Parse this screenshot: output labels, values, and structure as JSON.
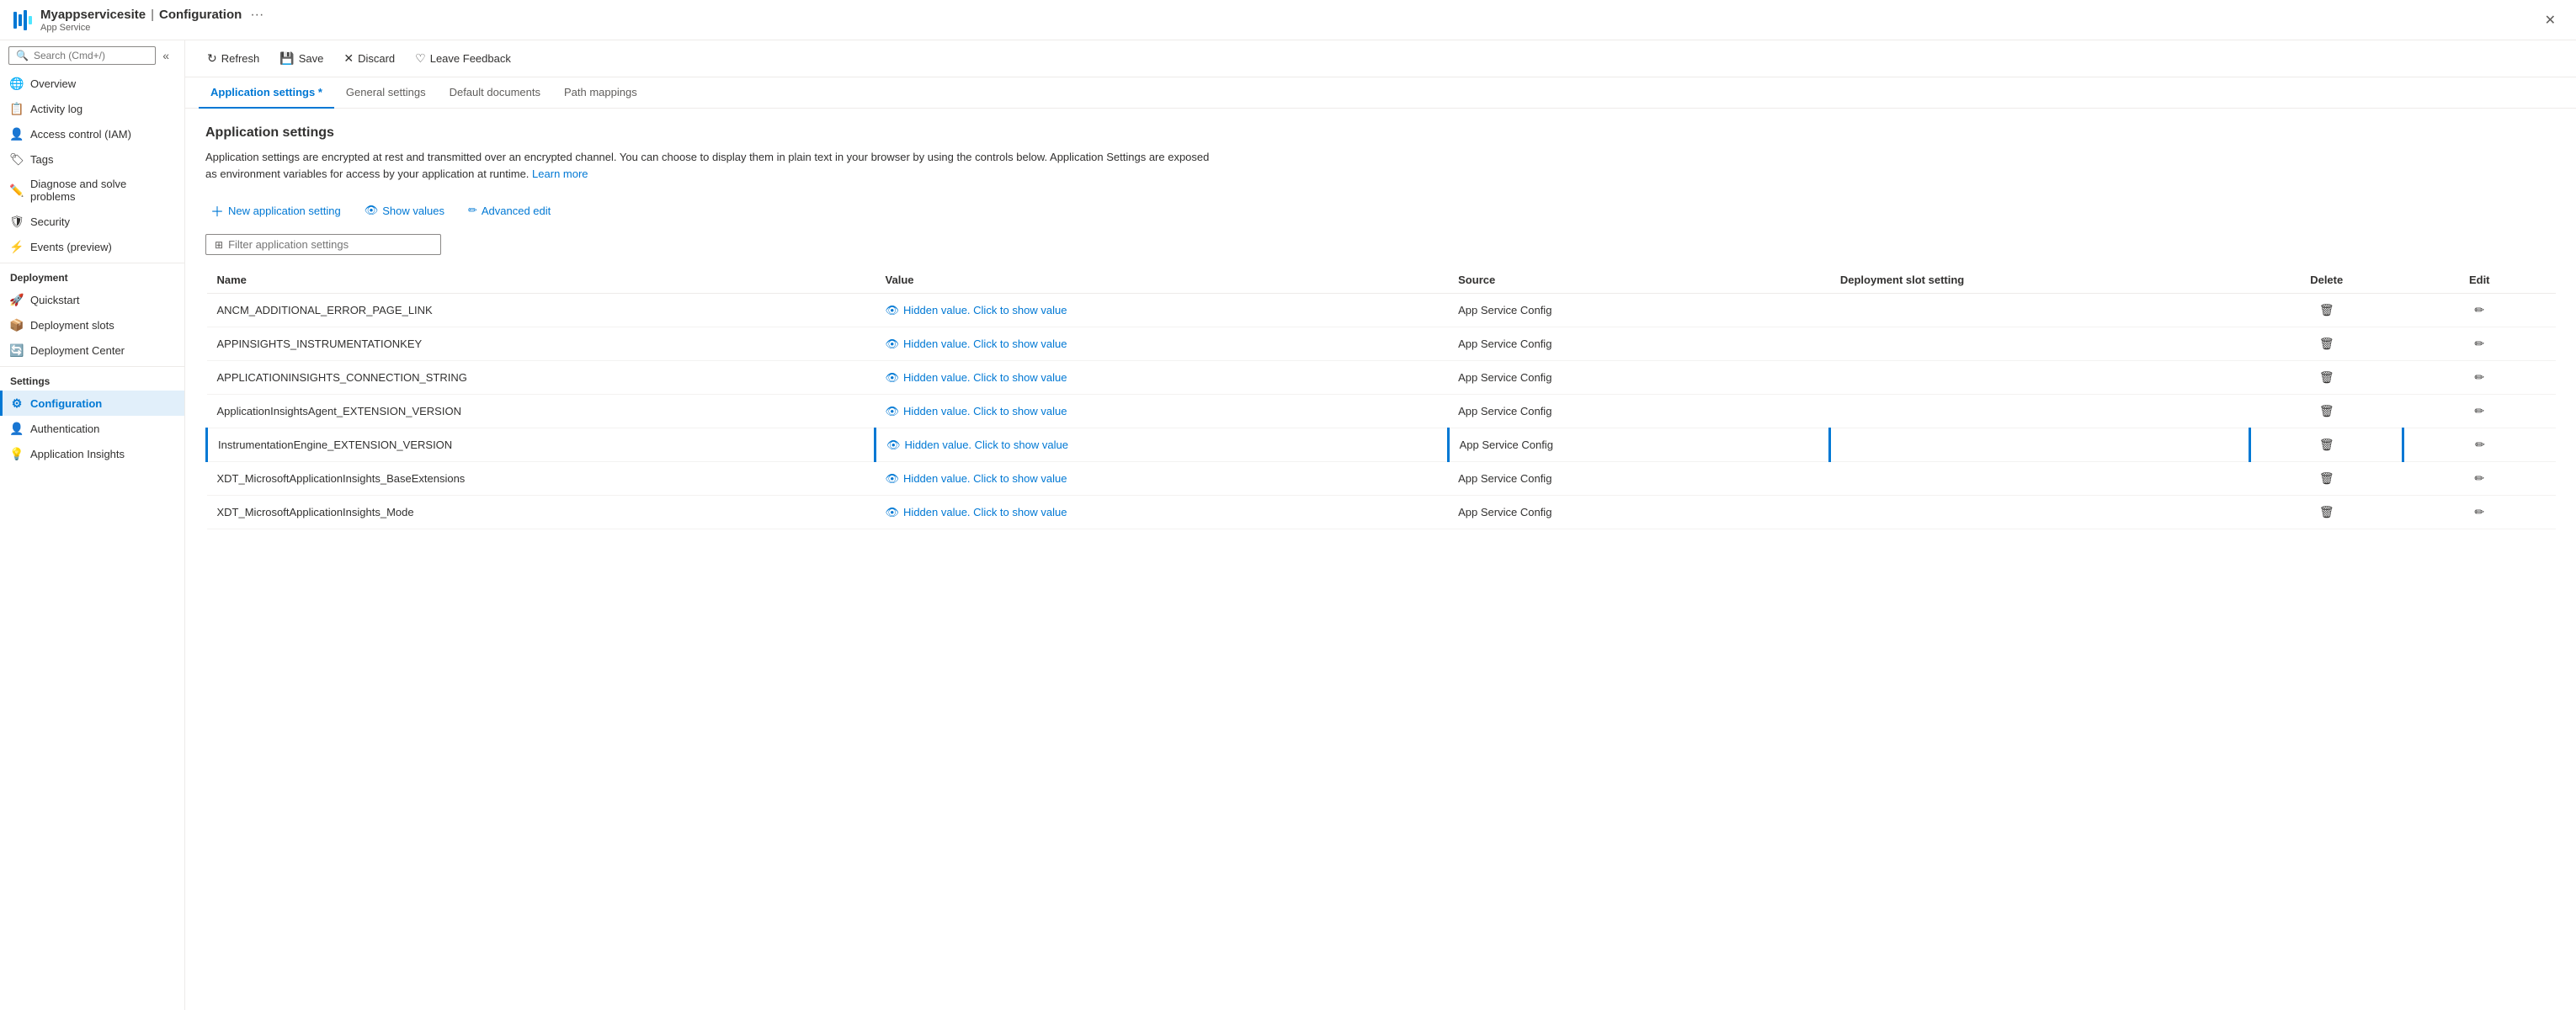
{
  "titleBar": {
    "appName": "Myappservicesite",
    "separator": "|",
    "pageName": "Configuration",
    "subTitle": "App Service",
    "ellipsis": "···",
    "closeLabel": "✕"
  },
  "toolbar": {
    "refreshLabel": "Refresh",
    "saveLabel": "Save",
    "discardLabel": "Discard",
    "feedbackLabel": "Leave Feedback"
  },
  "tabs": [
    {
      "id": "app-settings",
      "label": "Application settings",
      "asterisk": true,
      "active": true
    },
    {
      "id": "general-settings",
      "label": "General settings",
      "active": false
    },
    {
      "id": "default-docs",
      "label": "Default documents",
      "active": false
    },
    {
      "id": "path-mappings",
      "label": "Path mappings",
      "active": false
    }
  ],
  "pageContent": {
    "title": "Application settings",
    "description": "Application settings are encrypted at rest and transmitted over an encrypted channel. You can choose to display them in plain text in your browser by using the controls below. Application Settings are exposed as environment variables for access by your application at runtime.",
    "learnMoreLabel": "Learn more",
    "newSettingLabel": "New application setting",
    "showValuesLabel": "Show values",
    "advancedEditLabel": "Advanced edit",
    "filterPlaceholder": "Filter application settings",
    "tableHeaders": {
      "name": "Name",
      "value": "Value",
      "source": "Source",
      "deploymentSlot": "Deployment slot setting",
      "delete": "Delete",
      "edit": "Edit"
    },
    "rows": [
      {
        "name": "ANCM_ADDITIONAL_ERROR_PAGE_LINK",
        "value": "Hidden value. Click to show value",
        "source": "App Service Config",
        "deploymentSlot": "",
        "selected": false
      },
      {
        "name": "APPINSIGHTS_INSTRUMENTATIONKEY",
        "value": "Hidden value. Click to show value",
        "source": "App Service Config",
        "deploymentSlot": "",
        "selected": false
      },
      {
        "name": "APPLICATIONINSIGHTS_CONNECTION_STRING",
        "value": "Hidden value. Click to show value",
        "source": "App Service Config",
        "deploymentSlot": "",
        "selected": false
      },
      {
        "name": "ApplicationInsightsAgent_EXTENSION_VERSION",
        "value": "Hidden value. Click to show value",
        "source": "App Service Config",
        "deploymentSlot": "",
        "selected": false
      },
      {
        "name": "InstrumentationEngine_EXTENSION_VERSION",
        "value": "Hidden value. Click to show value",
        "source": "App Service Config",
        "deploymentSlot": "",
        "selected": true
      },
      {
        "name": "XDT_MicrosoftApplicationInsights_BaseExtensions",
        "value": "Hidden value. Click to show value",
        "source": "App Service Config",
        "deploymentSlot": "",
        "selected": false
      },
      {
        "name": "XDT_MicrosoftApplicationInsights_Mode",
        "value": "Hidden value. Click to show value",
        "source": "App Service Config",
        "deploymentSlot": "",
        "selected": false
      }
    ]
  },
  "sidebar": {
    "searchPlaceholder": "Search (Cmd+/)",
    "navItems": [
      {
        "id": "overview",
        "label": "Overview",
        "icon": "🌐",
        "active": false,
        "section": null
      },
      {
        "id": "activity-log",
        "label": "Activity log",
        "icon": "📋",
        "active": false,
        "section": null
      },
      {
        "id": "access-control",
        "label": "Access control (IAM)",
        "icon": "👤",
        "active": false,
        "section": null
      },
      {
        "id": "tags",
        "label": "Tags",
        "icon": "🏷",
        "active": false,
        "section": null
      },
      {
        "id": "diagnose",
        "label": "Diagnose and solve problems",
        "icon": "✏️",
        "active": false,
        "section": null
      },
      {
        "id": "security",
        "label": "Security",
        "icon": "🛡",
        "active": false,
        "section": null
      },
      {
        "id": "events",
        "label": "Events (preview)",
        "icon": "⚡",
        "active": false,
        "section": null
      }
    ],
    "sections": [
      {
        "title": "Deployment",
        "items": [
          {
            "id": "quickstart",
            "label": "Quickstart",
            "icon": "🚀"
          },
          {
            "id": "deployment-slots",
            "label": "Deployment slots",
            "icon": "📦"
          },
          {
            "id": "deployment-center",
            "label": "Deployment Center",
            "icon": "🔄"
          }
        ]
      },
      {
        "title": "Settings",
        "items": [
          {
            "id": "configuration",
            "label": "Configuration",
            "icon": "⚙",
            "active": true
          },
          {
            "id": "authentication",
            "label": "Authentication",
            "icon": "👤"
          },
          {
            "id": "application-insights",
            "label": "Application Insights",
            "icon": "💡"
          }
        ]
      }
    ]
  }
}
